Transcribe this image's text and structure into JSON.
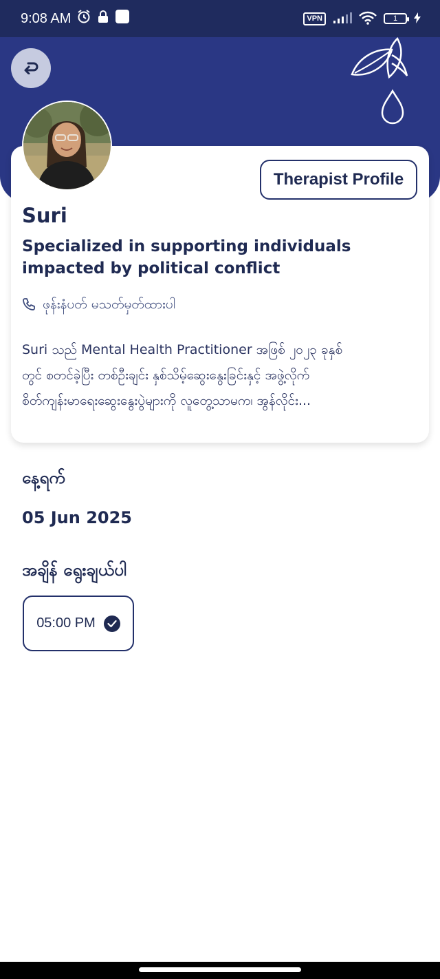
{
  "status_bar": {
    "time": "9:08 AM",
    "vpn": "VPN",
    "battery": "1",
    "icons": [
      "alarm-icon",
      "lock-icon",
      "notification-square-icon",
      "signal-icon",
      "wifi-icon",
      "charging-icon"
    ]
  },
  "header": {
    "back_icon": "back-arrow-icon",
    "decoration_icon": "leaf-droplet-icon"
  },
  "profile": {
    "badge": "Therapist Profile",
    "name": "Suri",
    "specialization": "Specialized in supporting individuals impacted by political conflict",
    "phone_text": "ဖုန်းနံပတ် မသတ်မှတ်ထားပါ",
    "bio_lines": [
      "Suri သည် Mental Health Practitioner အဖြစ် ၂၀၂၃ ခုနှစ်",
      "တွင် စတင်ခဲ့ပြီး တစ်ဦးချင်း နှစ်သိမ့်ဆွေးနွေးခြင်းနှင့် အဖွဲ့လိုက်",
      "စိတ်ကျန်းမာရေးဆွေးနွေးပွဲများကို လူတွေ့သာမက၊ အွန်လိုင်း..."
    ]
  },
  "date_section": {
    "label": "နေ့ရက်",
    "value": "05 Jun 2025"
  },
  "time_section": {
    "label": "အချိန် ရွေးချယ်ပါ",
    "selected_time": "05:00 PM"
  },
  "colors": {
    "header": "#2a3784",
    "status_bar": "#1f2b5e",
    "text": "#1f2a52",
    "back_button": "#c6cbe0"
  }
}
